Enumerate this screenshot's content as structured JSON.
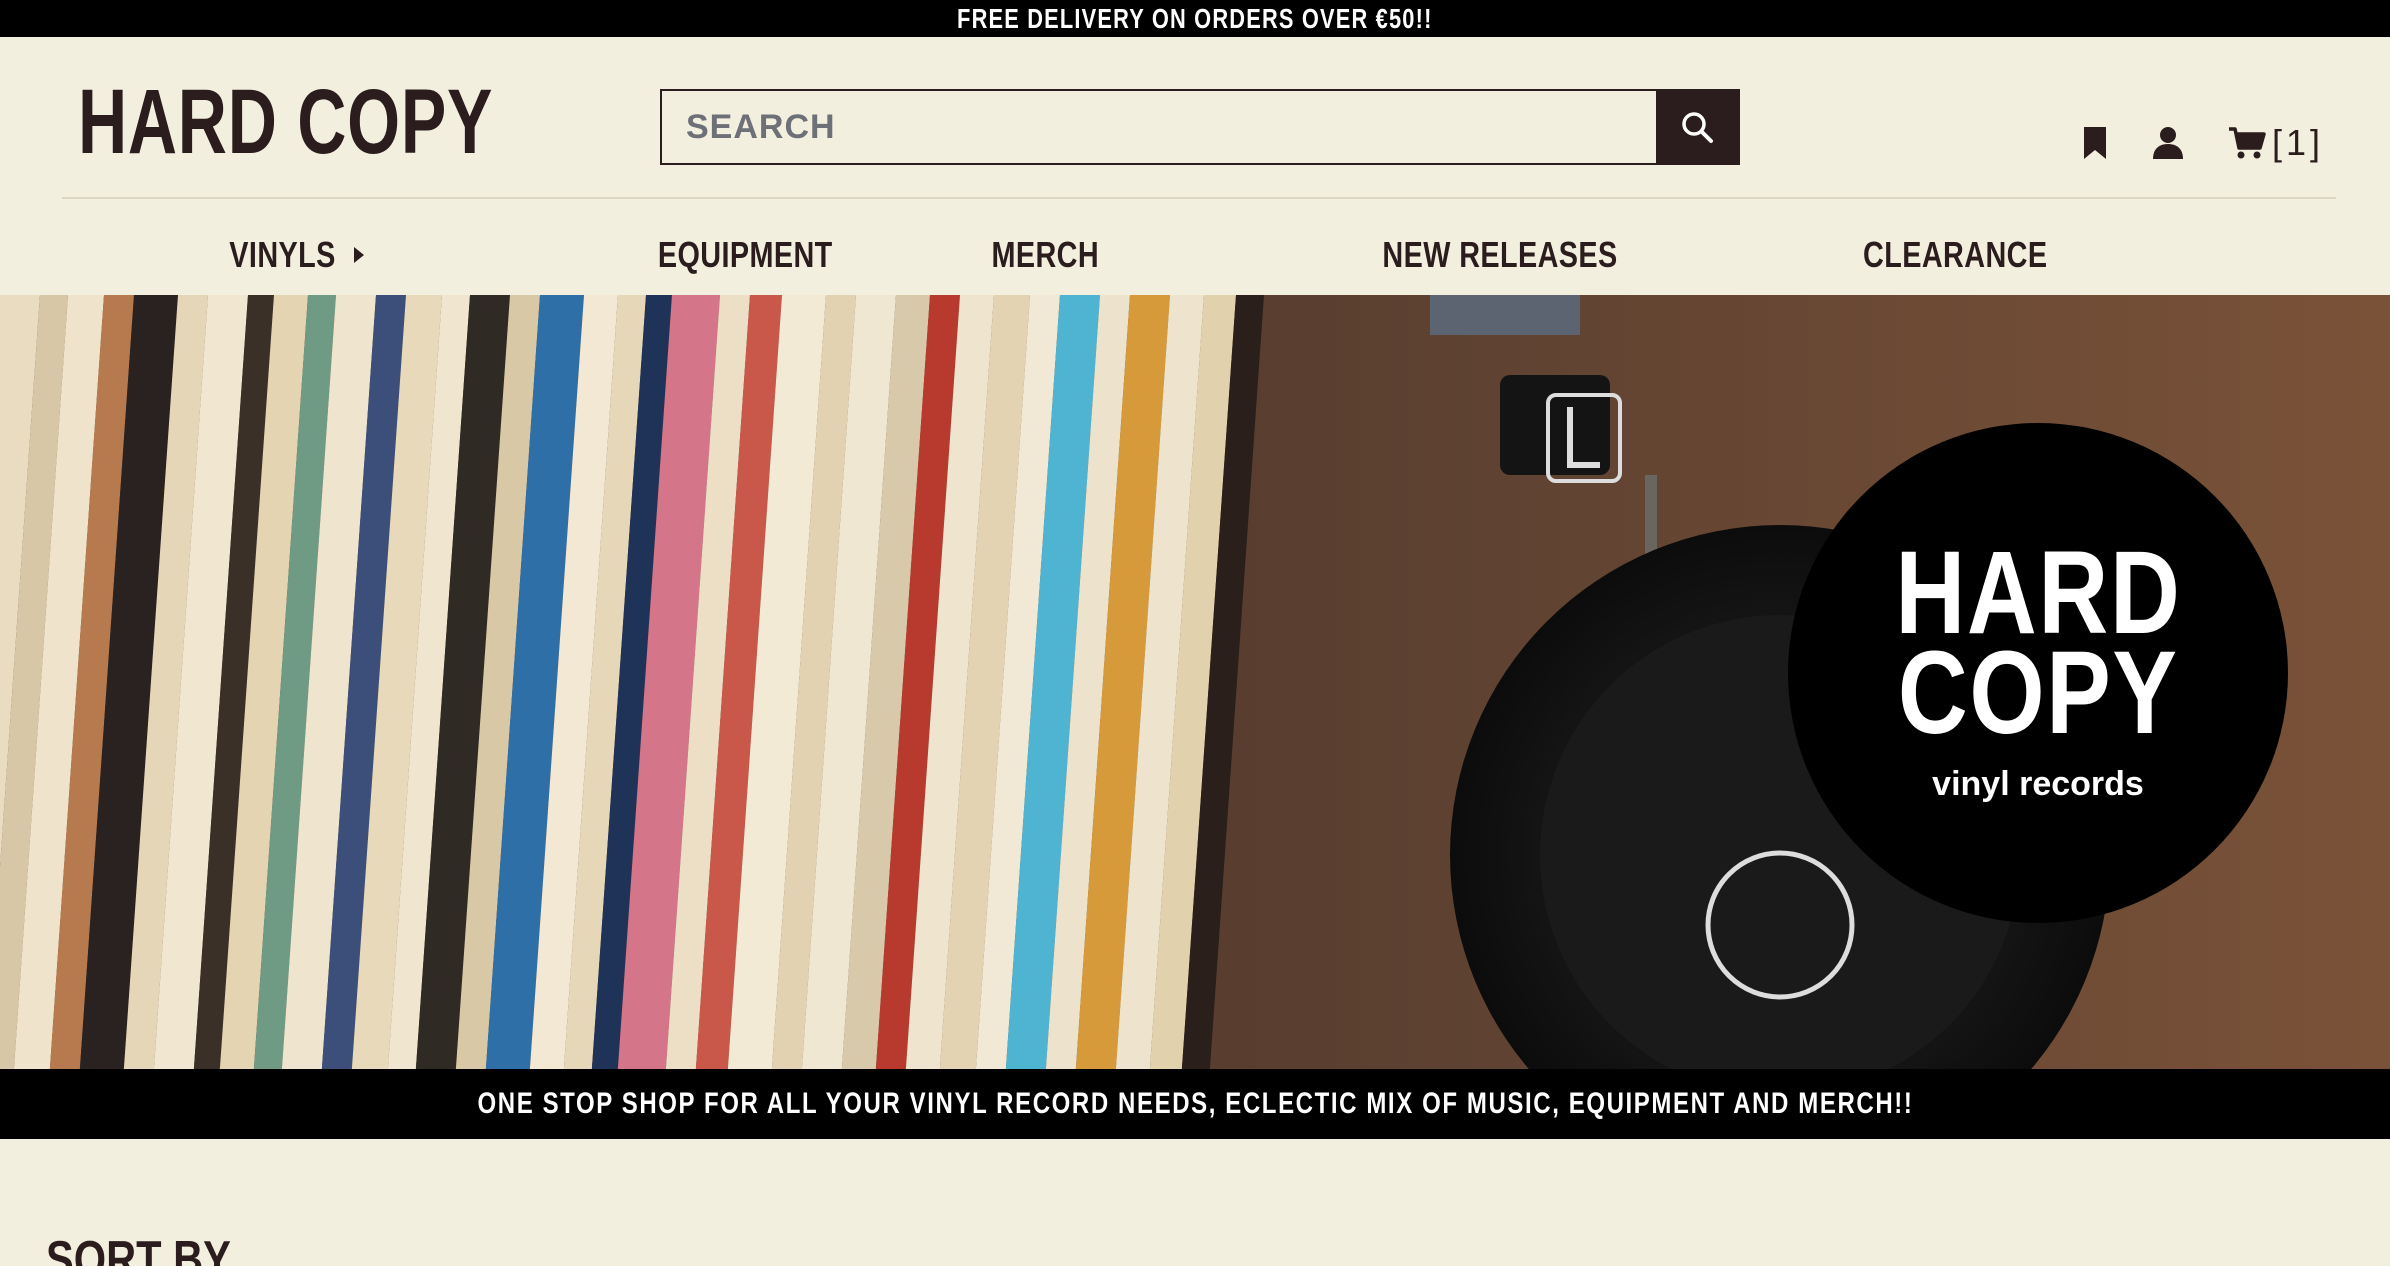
{
  "promo": {
    "text": "FREE DELIVERY ON ORDERS OVER €50!!"
  },
  "header": {
    "logo": "HARD COPY",
    "search": {
      "placeholder": "SEARCH",
      "value": ""
    },
    "cart_count": "[1]"
  },
  "nav": {
    "items": [
      {
        "label": "VINYLS"
      },
      {
        "label": "EQUIPMENT"
      },
      {
        "label": "MERCH"
      },
      {
        "label": "NEW RELEASES"
      },
      {
        "label": "CLEARANCE"
      }
    ]
  },
  "hero": {
    "badge_line1": "HARD",
    "badge_line2": "COPY",
    "badge_line3": "vinyl records"
  },
  "tagline": "ONE STOP SHOP FOR ALL YOUR VINYL RECORD NEEDS, ECLECTIC MIX OF MUSIC, EQUIPMENT AND MERCH!!",
  "sort": {
    "label": "SORT BY"
  },
  "colors": {
    "background": "#f3efdf",
    "text": "#2b1d1d",
    "bars": "#000000"
  },
  "icons": [
    "search-icon",
    "bookmark-icon",
    "user-icon",
    "cart-icon",
    "caret-right-icon"
  ]
}
